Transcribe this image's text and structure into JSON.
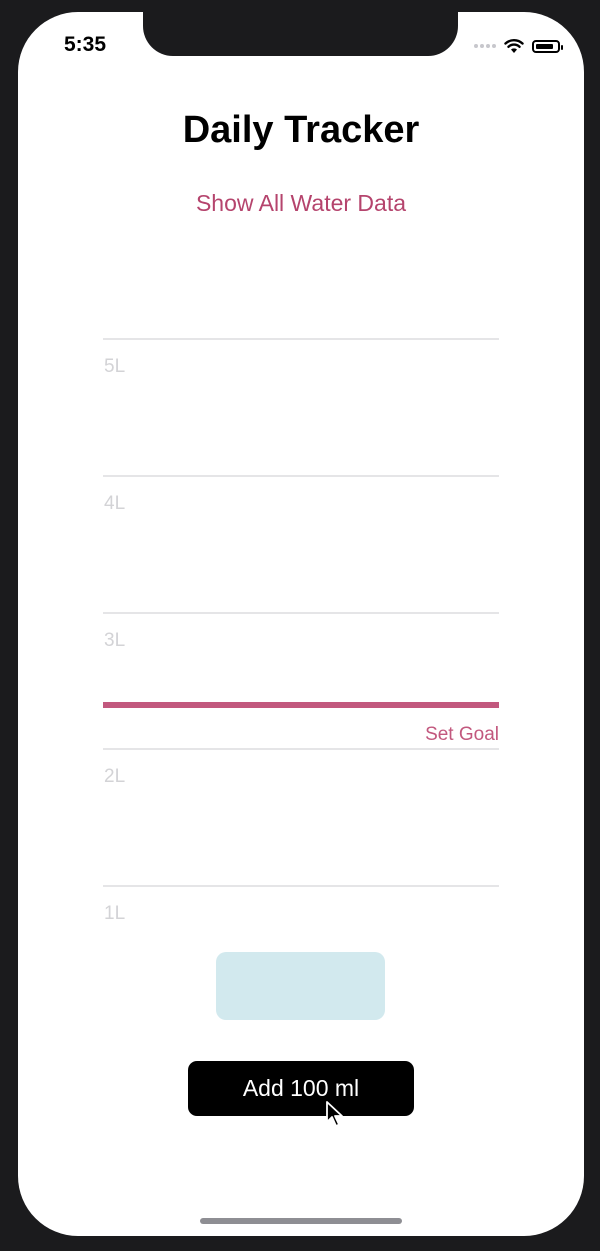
{
  "status_bar": {
    "time": "5:35"
  },
  "header": {
    "title": "Daily Tracker",
    "show_all_label": "Show All Water Data"
  },
  "chart": {
    "levels": [
      "5L",
      "4L",
      "3L",
      "2L",
      "1L"
    ],
    "goal_label": "Set Goal"
  },
  "actions": {
    "add_label": "Add 100 ml"
  }
}
